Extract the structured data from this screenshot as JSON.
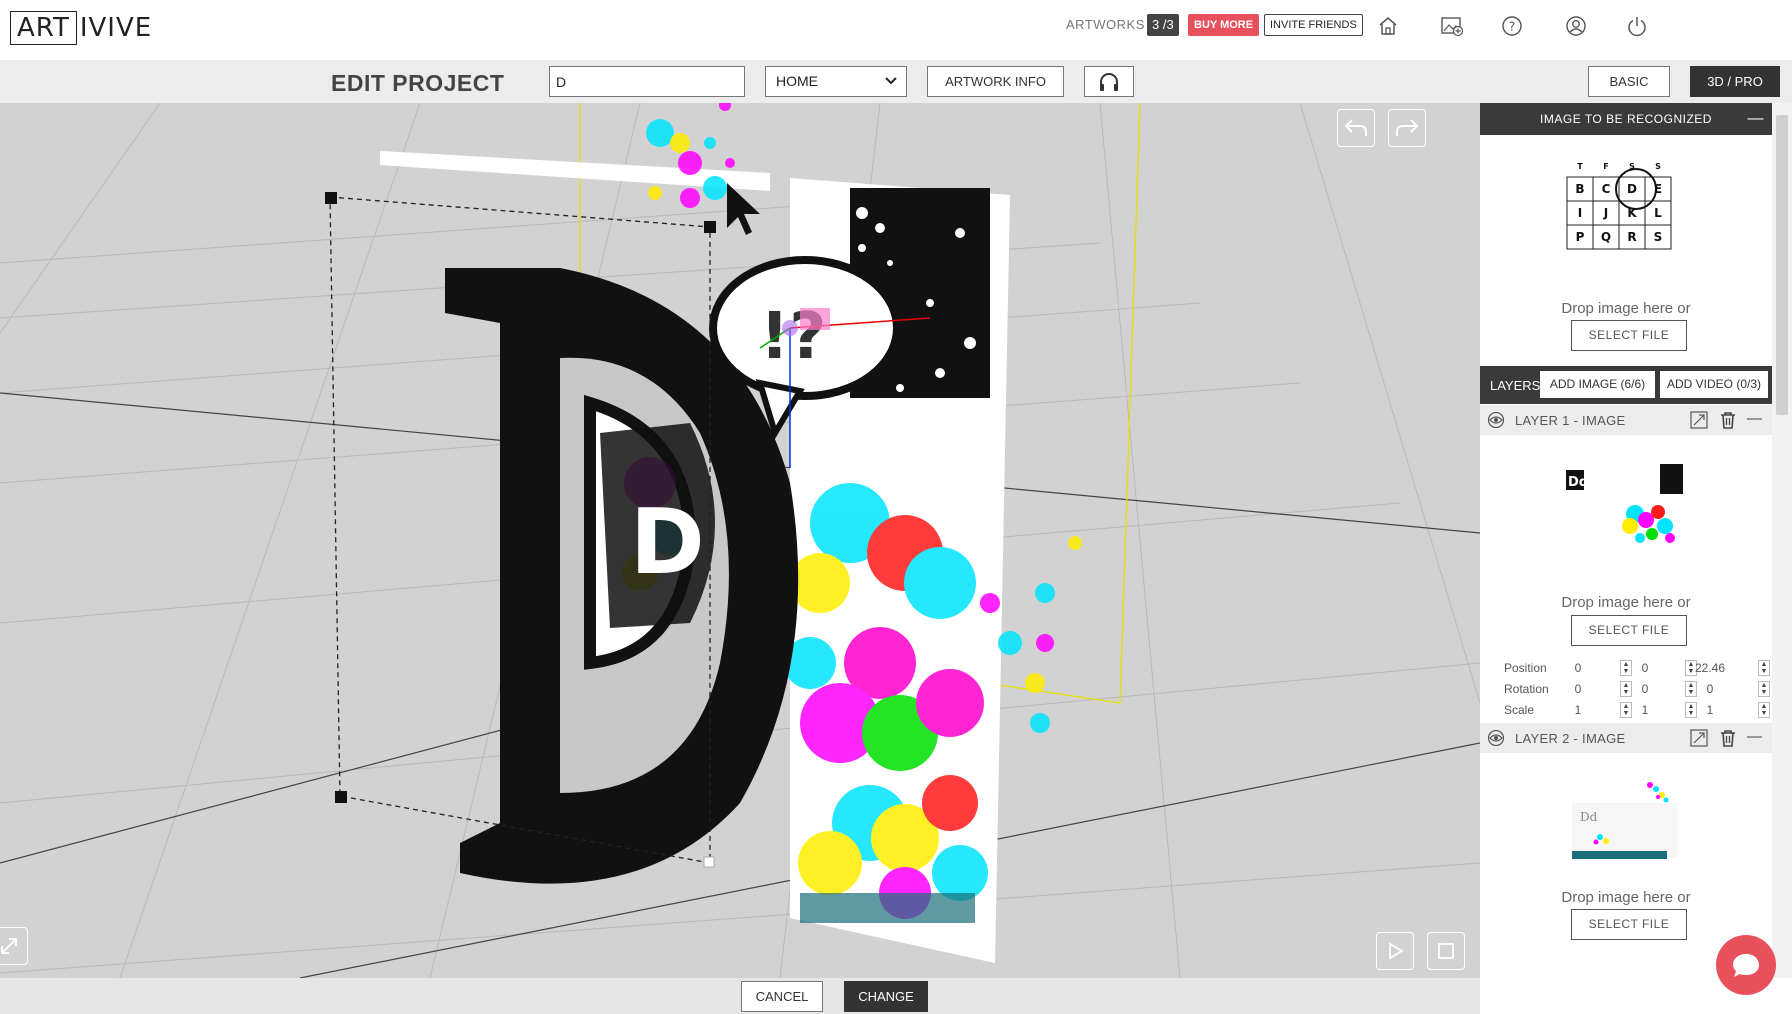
{
  "header": {
    "logo_boxed": "ART",
    "logo_rest": "IVIVE",
    "artworks_label": "ARTWORKS",
    "artworks_count": "3 /3",
    "buy_more": "BUY MORE",
    "invite_friends": "INVITE FRIENDS"
  },
  "toolbar": {
    "title": "EDIT PROJECT",
    "name_value": "D",
    "select_value": "HOME",
    "artwork_info": "ARTWORK INFO",
    "basic": "BASIC",
    "pro": "3D / PRO"
  },
  "panel": {
    "header": "IMAGE TO BE RECOGNIZED",
    "thumb_letters": [
      "T",
      "F",
      "S",
      "S",
      "B",
      "C",
      "D",
      "E",
      "I",
      "J",
      "K",
      "L",
      "P",
      "Q",
      "R",
      "S"
    ],
    "drop_text": "Drop image here or",
    "select_file": "SELECT FILE",
    "layers_label": "LAYERS",
    "add_image": "ADD IMAGE (6/6)",
    "add_video": "ADD VIDEO (0/3)",
    "layer1": {
      "title": "LAYER 1 - IMAGE",
      "drop_text": "Drop image here or",
      "select_file": "SELECT FILE",
      "position_label": "Position",
      "position": [
        "0",
        "0",
        "22.46"
      ],
      "rotation_label": "Rotation",
      "rotation": [
        "0",
        "0",
        "0"
      ],
      "scale_label": "Scale",
      "scale": [
        "1",
        "1",
        "1"
      ]
    },
    "layer2": {
      "title": "LAYER 2 - IMAGE",
      "drop_text": "Drop image here or",
      "select_file": "SELECT FILE"
    }
  },
  "footer": {
    "cancel": "CANCEL",
    "change": "CHANGE"
  },
  "canvas": {
    "speech_text": "!?",
    "mini_letter": "D"
  }
}
